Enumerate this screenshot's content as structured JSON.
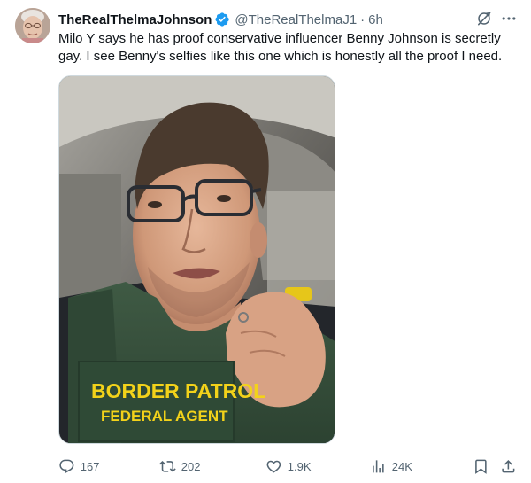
{
  "author": {
    "display_name": "TheRealThelmaJohnson",
    "handle": "@TheRealThelmaJ1",
    "separator": "·",
    "time": "6h",
    "avatar_icon": "avatar-elderly-woman",
    "verified_icon": "verified-badge-icon",
    "verified_color": "#1d9bf0"
  },
  "tweet": {
    "text_lines": [
      "Milo Y says he has proof conservative influencer Benny Johnson is secretly",
      "gay.  I see Benny's selfies like this one which is honestly all the proof I need."
    ]
  },
  "media": {
    "vest_line1": "BORDER PATROL",
    "vest_line2": "FEDERAL AGENT",
    "vest_text_color": "#f3d21a"
  },
  "header_actions": {
    "grok_icon": "grok-icon",
    "more_icon": "more-icon"
  },
  "actions": {
    "reply_count": "167",
    "retweet_count": "202",
    "like_count": "1.9K",
    "views_count": "24K"
  },
  "colors": {
    "text_primary": "#0f1419",
    "text_secondary": "#536471",
    "border": "#cfd9de"
  }
}
